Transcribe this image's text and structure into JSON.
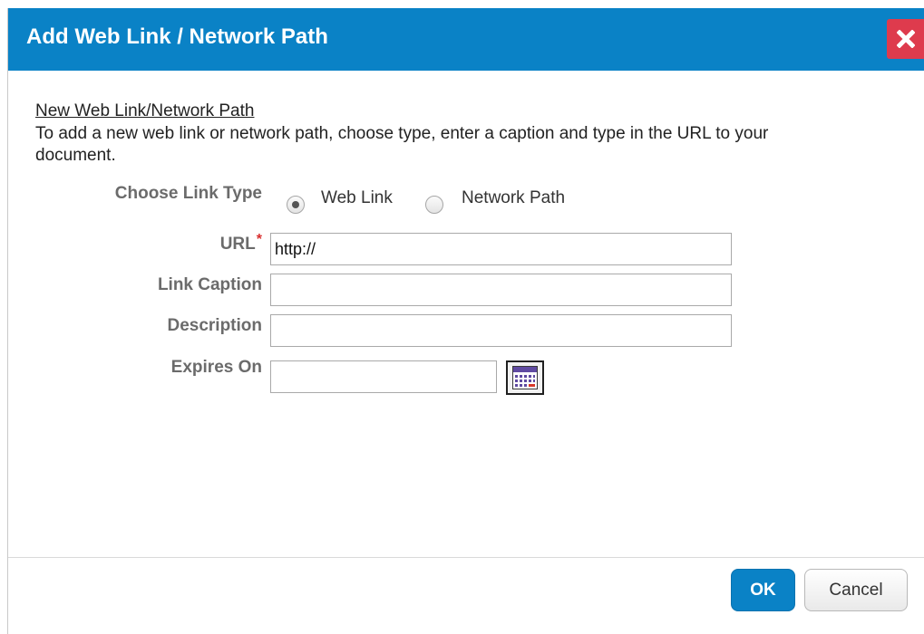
{
  "dialog": {
    "title": "Add Web Link / Network Path",
    "close_icon": "close-icon"
  },
  "form": {
    "heading": "New Web Link/Network Path",
    "intro": "To add a new web link or network path, choose type, enter a caption and type in the URL to your document.",
    "link_type": {
      "label": "Choose Link Type",
      "options": [
        {
          "label": "Web Link",
          "selected": true
        },
        {
          "label": "Network Path",
          "selected": false
        }
      ]
    },
    "url": {
      "label": "URL",
      "required_mark": "*",
      "value": "http://"
    },
    "caption": {
      "label": "Link Caption",
      "value": ""
    },
    "description": {
      "label": "Description",
      "value": ""
    },
    "expires": {
      "label": "Expires On",
      "value": "",
      "calendar_icon": "calendar-icon"
    }
  },
  "footer": {
    "ok_label": "OK",
    "cancel_label": "Cancel"
  },
  "colors": {
    "accent": "#0a82c6",
    "close": "#de3b4d",
    "required": "#d82d2d"
  }
}
